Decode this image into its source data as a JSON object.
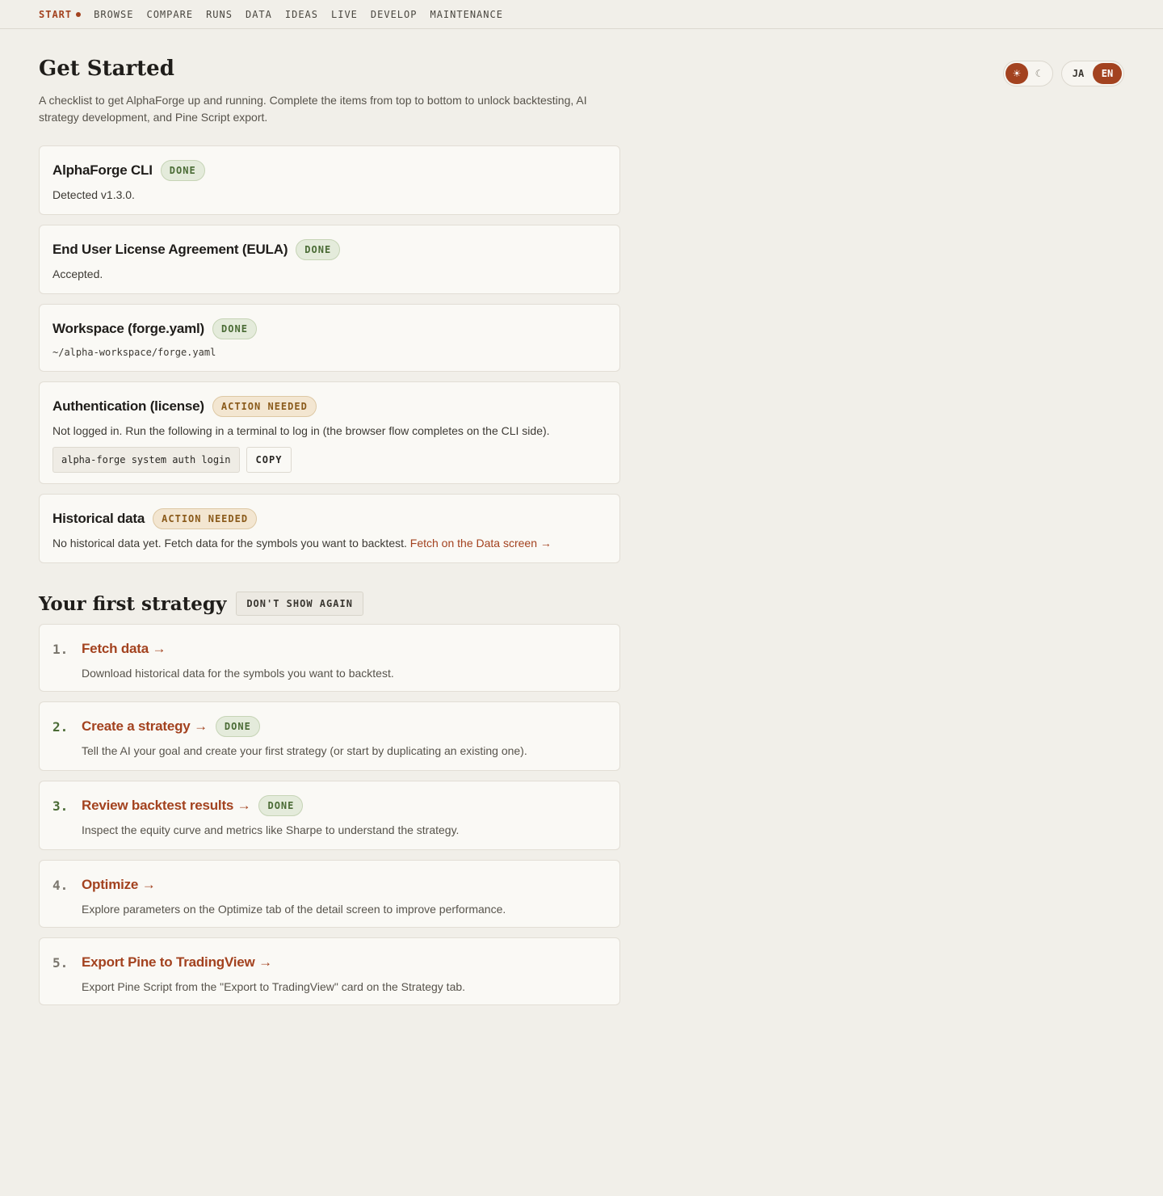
{
  "nav": {
    "items": [
      {
        "label": "START",
        "active": true
      },
      {
        "label": "BROWSE",
        "active": false
      },
      {
        "label": "COMPARE",
        "active": false
      },
      {
        "label": "RUNS",
        "active": false
      },
      {
        "label": "DATA",
        "active": false
      },
      {
        "label": "IDEAS",
        "active": false
      },
      {
        "label": "LIVE",
        "active": false
      },
      {
        "label": "DEVELOP",
        "active": false
      },
      {
        "label": "MAINTENANCE",
        "active": false
      }
    ]
  },
  "header": {
    "title": "Get Started",
    "subtitle": "A checklist to get AlphaForge up and running. Complete the items from top to bottom to unlock backtesting, AI strategy development, and Pine Script export."
  },
  "toggles": {
    "theme": {
      "light_icon": "☀",
      "dark_icon": "☾",
      "selected": "light"
    },
    "language": {
      "ja": "JA",
      "en": "EN",
      "selected": "EN"
    }
  },
  "checklist": [
    {
      "title": "AlphaForge CLI",
      "badge": "DONE",
      "status": "done",
      "desc": "Detected v1.3.0."
    },
    {
      "title": "End User License Agreement (EULA)",
      "badge": "DONE",
      "status": "done",
      "desc": "Accepted."
    },
    {
      "title": "Workspace (forge.yaml)",
      "badge": "DONE",
      "status": "done",
      "desc": "~/alpha-workspace/forge.yaml"
    },
    {
      "title": "Authentication (license)",
      "badge": "ACTION NEEDED",
      "status": "action",
      "desc": "Not logged in. Run the following in a terminal to log in (the browser flow completes on the CLI side).",
      "command": "alpha-forge system auth login",
      "copy_label": "COPY"
    },
    {
      "title": "Historical data",
      "badge": "ACTION NEEDED",
      "status": "action",
      "desc": "No historical data yet. Fetch data for the symbols you want to backtest.",
      "link": "Fetch on the Data screen →"
    }
  ],
  "first_strategy": {
    "title": "Your first strategy",
    "dismiss_label": "DON'T SHOW AGAIN",
    "steps": [
      {
        "num": "1.",
        "title": "Fetch data →",
        "done": false,
        "badge": "",
        "desc": "Download historical data for the symbols you want to backtest."
      },
      {
        "num": "2.",
        "title": "Create a strategy →",
        "done": true,
        "badge": "DONE",
        "desc": "Tell the AI your goal and create your first strategy (or start by duplicating an existing one)."
      },
      {
        "num": "3.",
        "title": "Review backtest results →",
        "done": true,
        "badge": "DONE",
        "desc": "Inspect the equity curve and metrics like Sharpe to understand the strategy."
      },
      {
        "num": "4.",
        "title": "Optimize →",
        "done": false,
        "badge": "",
        "desc": "Explore parameters on the Optimize tab of the detail screen to improve performance."
      },
      {
        "num": "5.",
        "title": "Export Pine to TradingView →",
        "done": false,
        "badge": "",
        "desc": "Export Pine Script from the \"Export to TradingView\" card on the Strategy tab."
      }
    ]
  },
  "colors": {
    "accent": "#a3421f",
    "done_bg": "#e4ebdb",
    "done_text": "#4a6b35",
    "action_bg": "#f3e6d1",
    "action_text": "#8a5a1a",
    "background": "#f1efe9"
  }
}
